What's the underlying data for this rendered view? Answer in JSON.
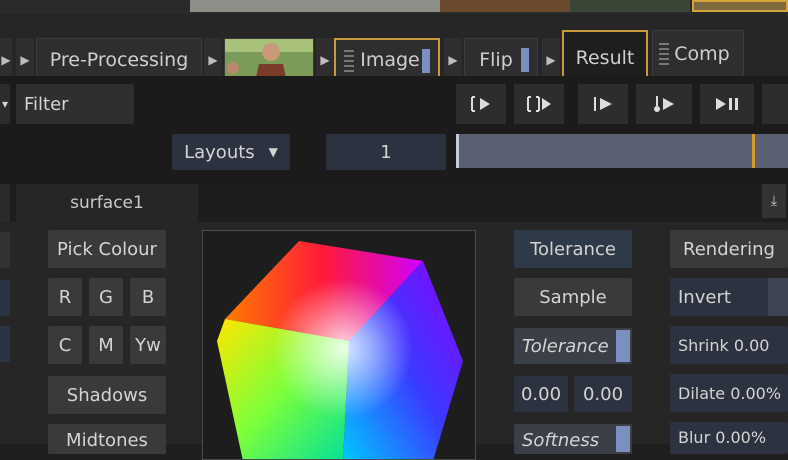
{
  "nodes": {
    "preprocessing": "Pre-Processing",
    "image": "Image",
    "flip": "Flip",
    "result": "Result",
    "comp": "Comp"
  },
  "toolbar": {
    "filter": "Filter",
    "layouts": "Layouts",
    "frame": "1"
  },
  "tab": {
    "surface": "surface1"
  },
  "left_buttons": {
    "pick_colour": "Pick Colour",
    "r": "R",
    "g": "G",
    "b": "B",
    "c": "C",
    "m": "M",
    "yw": "Yw",
    "shadows": "Shadows",
    "midtones": "Midtones"
  },
  "right_col1": {
    "tolerance_header": "Tolerance",
    "sample": "Sample",
    "tolerance_slider": "Tolerance",
    "val1": "0.00",
    "val2": "0.00",
    "softness": "Softness"
  },
  "right_col2": {
    "rendering": "Rendering",
    "invert": "Invert",
    "shrink": "Shrink 0.00",
    "dilate": "Dilate 0.00%",
    "blur": "Blur 0.00%"
  },
  "colors": {
    "accent_orange": "#c79a3c",
    "accent_blue": "#7b8fc0",
    "timeline": "#5b5f72"
  }
}
